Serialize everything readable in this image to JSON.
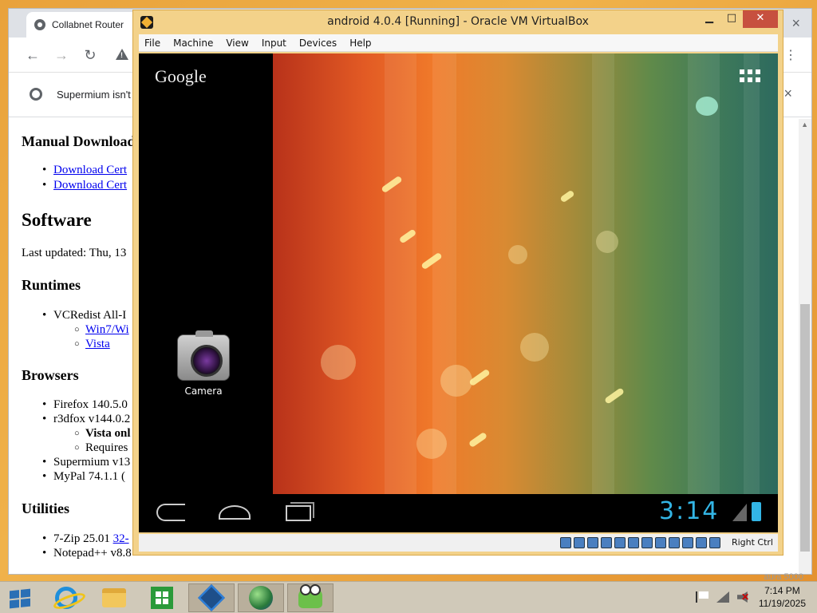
{
  "browser": {
    "tab_title": "Collabnet Router",
    "infobar_text": "Supermium isn't",
    "content": {
      "heading_downloads": "Manual Download",
      "links": [
        "Download Cert",
        "Download Cert"
      ],
      "heading_software": "Software",
      "last_updated": "Last updated: Thu, 13",
      "heading_runtimes": "Runtimes",
      "runtime_item": "VCRedist All-I",
      "runtime_links": [
        "Win7/Wi",
        "Vista"
      ],
      "heading_browsers": "Browsers",
      "browser_items": [
        "Firefox 140.5.0",
        "r3dfox v144.0.2"
      ],
      "browser_subitems": [
        "Vista onl",
        "Requires"
      ],
      "browser_items_more": [
        "Supermium v13",
        "MyPal 74.1.1 ("
      ],
      "heading_utilities": "Utilities",
      "utility_7zip": "7-Zip 25.01",
      "utility_7zip_link": "32-",
      "utility_notepad": "Notepad++ v8.8",
      "right_bottom_text": "aura 5000"
    }
  },
  "vbox": {
    "title": "android 4.0.4 [Running] - Oracle VM VirtualBox",
    "minimize": "▁",
    "maximize": "□",
    "close": "✕",
    "menu": [
      "File",
      "Machine",
      "View",
      "Input",
      "Devices",
      "Help"
    ],
    "host_key": "Right Ctrl"
  },
  "android": {
    "google_label": "Google",
    "camera_label": "Camera",
    "clock": "3:14"
  },
  "taskbar": {
    "time": "7:14 PM",
    "date": "11/19/2025"
  }
}
